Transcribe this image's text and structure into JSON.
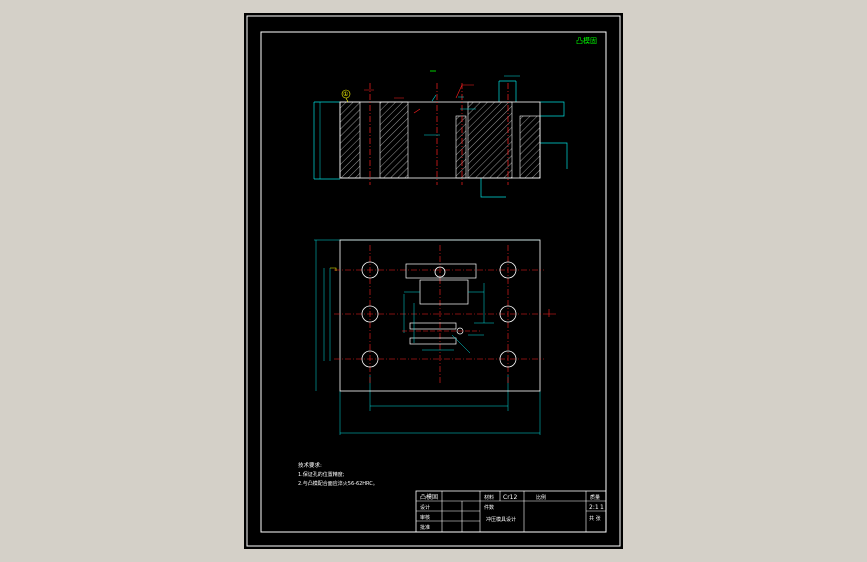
{
  "colors": {
    "frame": "#ffffff",
    "outline": "#ffffff",
    "center_line": "#ff2020",
    "hatch": "#ffffff",
    "dimension": "#00e0e0",
    "background": "#000000",
    "viewport": "#d4d0c8",
    "leader": "#ffff00",
    "stamp": "#00ff00"
  },
  "drawing": {
    "corner_stamp": "凸模固",
    "part_mark": "①"
  },
  "tech_notes": {
    "heading": "技术要求:",
    "line1": "1.保证孔的位置精度;",
    "line2": "2.与凸模配合面应淬火56-62HRC。"
  },
  "title_block": {
    "part_name": "凸模固",
    "material_label": "材料",
    "material_value": "Cr12",
    "scale_label": "比例",
    "weight_label": "质量",
    "qty_label": "件数",
    "qty_value": "2:1",
    "sheet_value": "1",
    "designer_label": "设计",
    "checker_label": "审核",
    "approver_label": "批准",
    "dept_label": "共 张",
    "drawing_no": "冲压模具设计"
  }
}
